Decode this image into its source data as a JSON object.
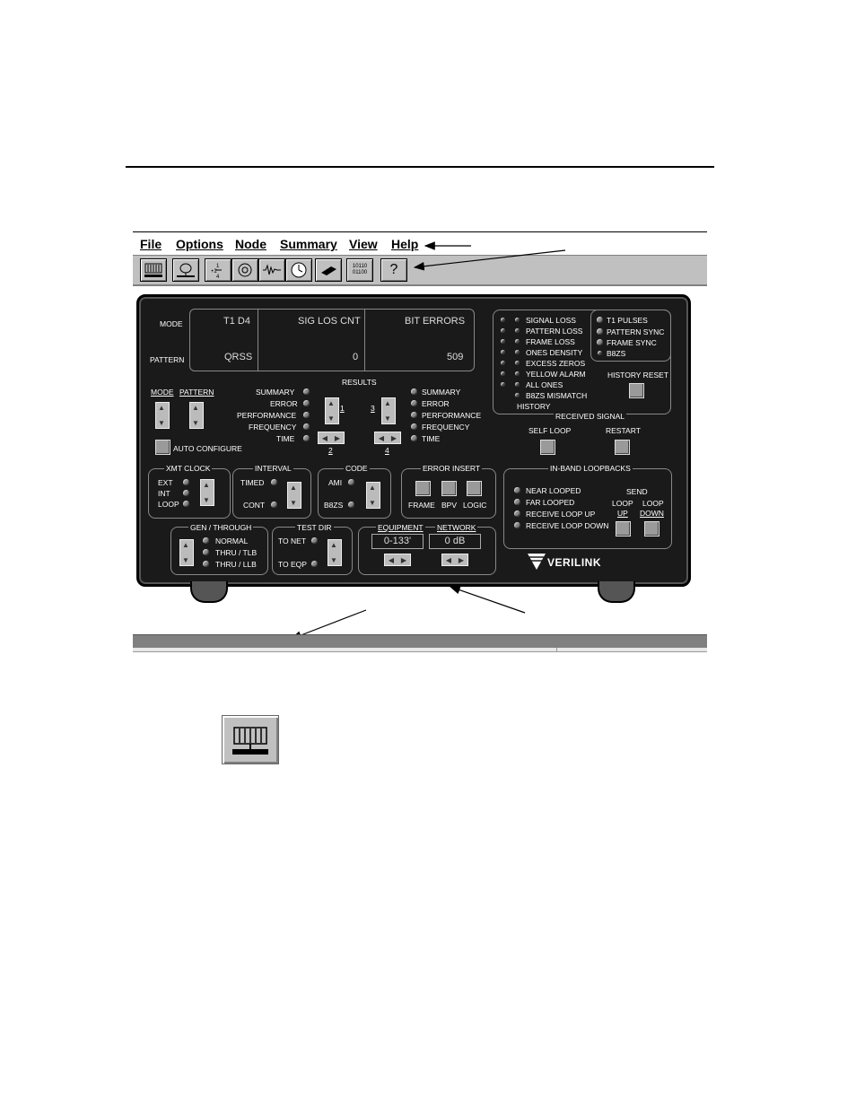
{
  "menubar": {
    "items": [
      "File",
      "Options",
      "Node",
      "Summary",
      "View",
      "Help"
    ]
  },
  "toolbar": {
    "icons": [
      "front-panel-icon",
      "network-icon",
      "fraction-icon",
      "stats-icon",
      "waveform-icon",
      "clock-icon",
      "card-icon",
      "binary-icon",
      "help-icon"
    ],
    "binary_text": "10110 01100",
    "help_text": "?"
  },
  "panel": {
    "mode_label": "MODE",
    "pattern_label": "PATTERN",
    "mode_value": "T1 D4",
    "pattern_value": "QRSS",
    "sig_los_label": "SIG LOS CNT",
    "sig_los_value": "0",
    "bit_errors_label": "BIT ERRORS",
    "bit_errors_value": "509",
    "mode_ctrl": "MODE",
    "pattern_ctrl": "PATTERN",
    "auto_configure": "AUTO CONFIGURE",
    "results_title": "RESULTS",
    "results_left": [
      "SUMMARY",
      "ERROR",
      "PERFORMANCE",
      "FREQUENCY",
      "TIME"
    ],
    "results_right": [
      "SUMMARY",
      "ERROR",
      "PERFORMANCE",
      "FREQUENCY",
      "TIME"
    ],
    "sel1": "1",
    "sel2": "2",
    "sel3": "3",
    "sel4": "4",
    "status_items": [
      "SIGNAL LOSS",
      "PATTERN LOSS",
      "FRAME LOSS",
      "ONES DENSITY",
      "EXCESS ZEROS",
      "YELLOW ALARM",
      "ALL ONES",
      "B8ZS MISMATCH"
    ],
    "history": "HISTORY",
    "signal_items": [
      "T1 PULSES",
      "PATTERN SYNC",
      "FRAME SYNC",
      "B8ZS"
    ],
    "history_reset": "HISTORY RESET",
    "received_signal": "RECEIVED SIGNAL",
    "self_loop": "SELF LOOP",
    "restart": "RESTART",
    "xmt_clock": "XMT CLOCK",
    "xmt_items": [
      "EXT",
      "INT",
      "LOOP"
    ],
    "interval": "INTERVAL",
    "interval_items": [
      "TIMED",
      "CONT"
    ],
    "code": "CODE",
    "code_items": [
      "AMI",
      "B8ZS"
    ],
    "error_insert": "ERROR INSERT",
    "error_items": [
      "FRAME",
      "BPV",
      "LOGIC"
    ],
    "inband": "IN-BAND LOOPBACKS",
    "inband_items": [
      "NEAR LOOPED",
      "FAR LOOPED",
      "RECEIVE LOOP UP",
      "RECEIVE LOOP DOWN"
    ],
    "send": "SEND",
    "loop_up": [
      "LOOP",
      "UP"
    ],
    "loop_down": [
      "LOOP",
      "DOWN"
    ],
    "gen_through": "GEN / THROUGH",
    "gen_items": [
      "NORMAL",
      "THRU / TLB",
      "THRU / LLB"
    ],
    "test_dir": "TEST DIR",
    "test_items": [
      "TO NET",
      "TO EQP"
    ],
    "equipment": "EQUIPMENT",
    "equipment_value": "0-133'",
    "network": "NETWORK",
    "network_value": "0 dB",
    "brand": "VERILINK"
  },
  "colors": {
    "panel_bg": "#1a1a1a",
    "toolbar_bg": "#c0c0c0",
    "status_bg": "#808080"
  }
}
